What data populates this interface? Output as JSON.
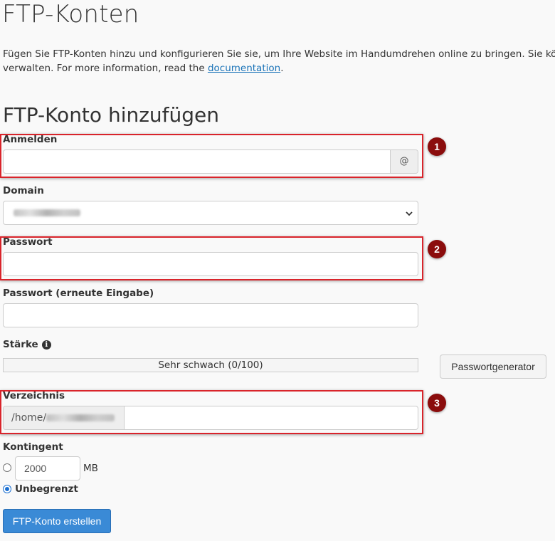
{
  "page": {
    "title": "FTP-Konten",
    "intro_line1": "Fügen Sie FTP-Konten hinzu und konfigurieren Sie sie, um Ihre Website im Handumdrehen online zu bringen. Sie können",
    "intro_line2_prefix": "verwalten. For more information, read the",
    "intro_link": "documentation",
    "intro_line2_suffix": "."
  },
  "form": {
    "section_title": "FTP-Konto hinzufügen",
    "login": {
      "label": "Anmelden",
      "value": "",
      "addon": "@"
    },
    "domain": {
      "label": "Domain"
    },
    "password": {
      "label": "Passwort",
      "value": ""
    },
    "password_repeat": {
      "label": "Passwort (erneute Eingabe)",
      "value": ""
    },
    "strength": {
      "label": "Stärke",
      "text": "Sehr schwach (0/100)",
      "percent": 0
    },
    "generator_button": "Passwortgenerator",
    "directory": {
      "label": "Verzeichnis",
      "prefix": "/home/",
      "value": ""
    },
    "quota": {
      "label": "Kontingent",
      "value": "2000",
      "unit": "MB",
      "unlimited_label": "Unbegrenzt",
      "selected": "unlimited"
    },
    "submit_button": "FTP-Konto erstellen"
  },
  "annotations": [
    "1",
    "2",
    "3"
  ],
  "colors": {
    "highlight": "#d9242b",
    "marker": "#8b0d0d",
    "primary_button": "#3a8ad6",
    "link": "#1a73b8"
  }
}
